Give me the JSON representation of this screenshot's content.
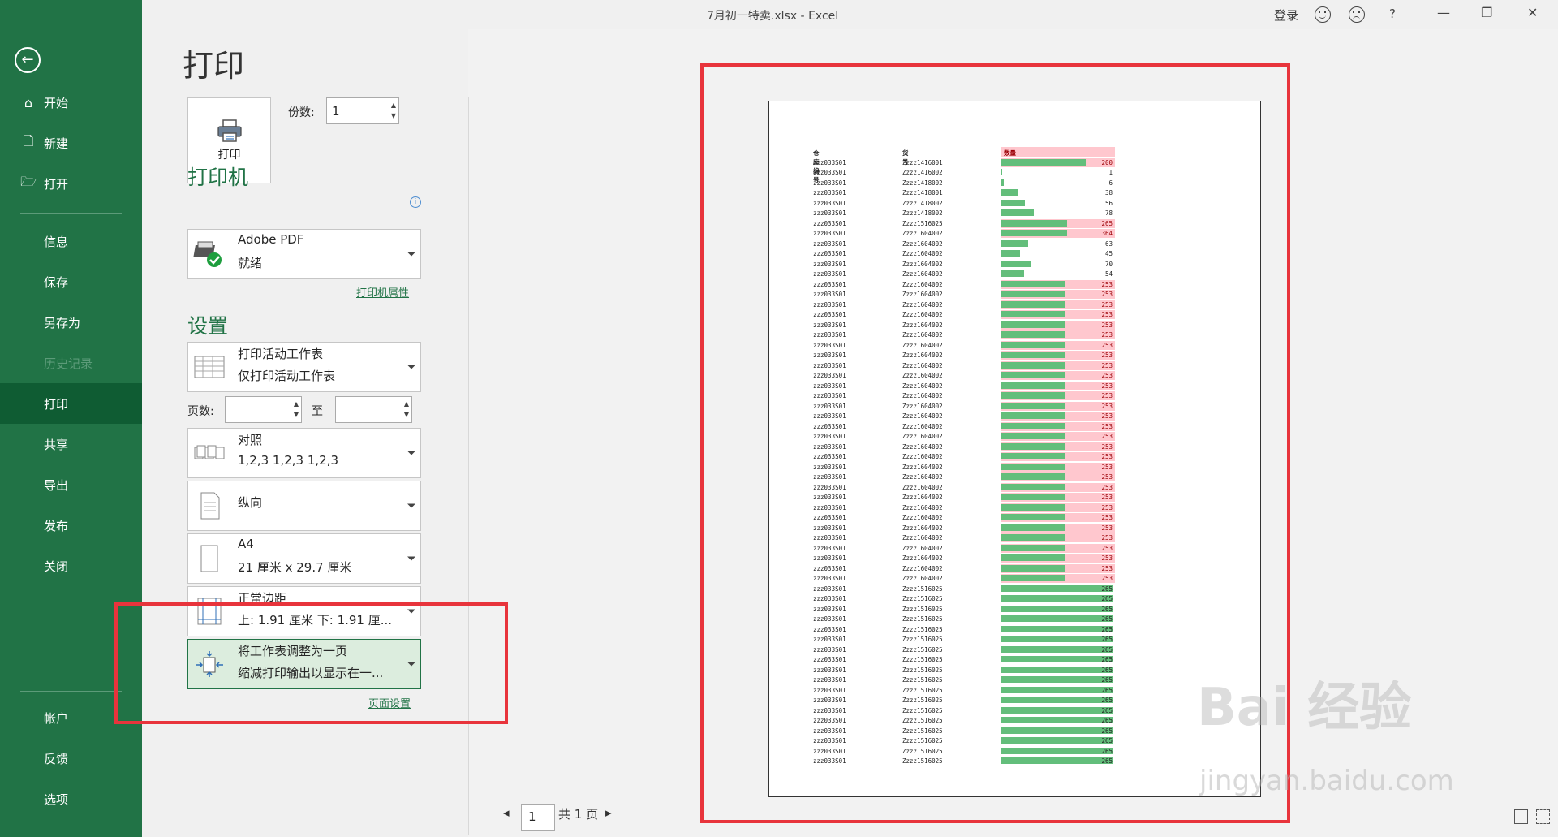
{
  "titlebar": {
    "doc_title": "7月初一特卖.xlsx  -  Excel",
    "signin": "登录",
    "help": "?",
    "minimize": "—",
    "restore": "❐",
    "close": "✕"
  },
  "backstage": {
    "back_glyph": "←",
    "items_top": [
      {
        "label": "开始",
        "icon": "home-icon",
        "glyph": "⌂"
      },
      {
        "label": "新建",
        "icon": "new-file-icon",
        "glyph": "🗋"
      },
      {
        "label": "打开",
        "icon": "open-folder-icon",
        "glyph": "🗁"
      }
    ],
    "items_mid": [
      "信息",
      "保存",
      "另存为",
      "历史记录",
      "打印",
      "共享",
      "导出",
      "发布",
      "关闭"
    ],
    "items_bottom": [
      "帐户",
      "反馈",
      "选项"
    ],
    "active": "打印",
    "disabled": "历史记录"
  },
  "print_panel": {
    "title": "打印",
    "print_button": "打印",
    "copies_label": "份数:",
    "copies_value": "1",
    "printer_heading": "打印机",
    "printer_name": "Adobe PDF",
    "printer_status": "就绪",
    "printer_props_link": "打印机属性",
    "settings_heading": "设置",
    "what_to_print": {
      "l1": "打印活动工作表",
      "l2": "仅打印活动工作表"
    },
    "pages_label": "页数:",
    "pages_to_label": "至",
    "collate": {
      "l1": "对照",
      "l2": "1,2,3     1,2,3     1,2,3"
    },
    "orientation": "纵向",
    "paper": {
      "l1": "A4",
      "l2": "21 厘米 x 29.7 厘米"
    },
    "margins": {
      "l1": "正常边距",
      "l2": "上: 1.91 厘米 下: 1.91 厘..."
    },
    "scaling": {
      "l1": "将工作表调整为一页",
      "l2": "缩减打印输出以显示在一..."
    },
    "page_setup_link": "页面设置"
  },
  "preview": {
    "page_number": "1",
    "total_pages": "共 1 页",
    "prev_glyph": "◂",
    "next_glyph": "▸",
    "sheet": {
      "headers": [
        "仓库编号",
        "货号",
        "数量"
      ],
      "max_value": 265,
      "rows": [
        [
          "zzz033S01",
          "Zzzz1416001",
          200,
          true
        ],
        [
          "zzz033S01",
          "Zzzz1416002",
          1,
          false
        ],
        [
          "zzz033S01",
          "Zzzz1418002",
          6,
          false
        ],
        [
          "zzz033S01",
          "Zzzz1418001",
          38,
          false
        ],
        [
          "zzz033S01",
          "Zzzz1418002",
          56,
          false
        ],
        [
          "zzz033S01",
          "Zzzz1418002",
          78,
          false
        ],
        [
          "zzz033S01",
          "Zzzz1516025",
          265,
          true
        ],
        [
          "zzz033S01",
          "Zzzz1604002",
          364,
          true
        ],
        [
          "zzz033S01",
          "Zzzz1604002",
          63,
          false
        ],
        [
          "zzz033S01",
          "Zzzz1604002",
          45,
          false
        ],
        [
          "zzz033S01",
          "Zzzz1604002",
          70,
          false
        ],
        [
          "zzz033S01",
          "Zzzz1604002",
          54,
          false
        ],
        [
          "zzz033S01",
          "Zzzz1604002",
          253,
          true
        ],
        [
          "zzz033S01",
          "Zzzz1604002",
          253,
          true
        ],
        [
          "zzz033S01",
          "Zzzz1604002",
          253,
          true
        ],
        [
          "zzz033S01",
          "Zzzz1604002",
          253,
          true
        ],
        [
          "zzz033S01",
          "Zzzz1604002",
          253,
          true
        ],
        [
          "zzz033S01",
          "Zzzz1604002",
          253,
          true
        ],
        [
          "zzz033S01",
          "Zzzz1604002",
          253,
          true
        ],
        [
          "zzz033S01",
          "Zzzz1604002",
          253,
          true
        ],
        [
          "zzz033S01",
          "Zzzz1604002",
          253,
          true
        ],
        [
          "zzz033S01",
          "Zzzz1604002",
          253,
          true
        ],
        [
          "zzz033S01",
          "Zzzz1604002",
          253,
          true
        ],
        [
          "zzz033S01",
          "Zzzz1604002",
          253,
          true
        ],
        [
          "zzz033S01",
          "Zzzz1604002",
          253,
          true
        ],
        [
          "zzz033S01",
          "Zzzz1604002",
          253,
          true
        ],
        [
          "zzz033S01",
          "Zzzz1604002",
          253,
          true
        ],
        [
          "zzz033S01",
          "Zzzz1604002",
          253,
          true
        ],
        [
          "zzz033S01",
          "Zzzz1604002",
          253,
          true
        ],
        [
          "zzz033S01",
          "Zzzz1604002",
          253,
          true
        ],
        [
          "zzz033S01",
          "Zzzz1604002",
          253,
          true
        ],
        [
          "zzz033S01",
          "Zzzz1604002",
          253,
          true
        ],
        [
          "zzz033S01",
          "Zzzz1604002",
          253,
          true
        ],
        [
          "zzz033S01",
          "Zzzz1604002",
          253,
          true
        ],
        [
          "zzz033S01",
          "Zzzz1604002",
          253,
          true
        ],
        [
          "zzz033S01",
          "Zzzz1604002",
          253,
          true
        ],
        [
          "zzz033S01",
          "Zzzz1604002",
          253,
          true
        ],
        [
          "zzz033S01",
          "Zzzz1604002",
          253,
          true
        ],
        [
          "zzz033S01",
          "Zzzz1604002",
          253,
          true
        ],
        [
          "zzz033S01",
          "Zzzz1604002",
          253,
          true
        ],
        [
          "zzz033S01",
          "Zzzz1604002",
          253,
          true
        ],
        [
          "zzz033S01",
          "Zzzz1604002",
          253,
          true
        ],
        [
          "zzz033S01",
          "Zzzz1516025",
          265,
          false
        ],
        [
          "zzz033S01",
          "Zzzz1516025",
          265,
          false
        ],
        [
          "zzz033S01",
          "Zzzz1516025",
          265,
          false
        ],
        [
          "zzz033S01",
          "Zzzz1516025",
          265,
          false
        ],
        [
          "zzz033S01",
          "Zzzz1516025",
          265,
          false
        ],
        [
          "zzz033S01",
          "Zzzz1516025",
          265,
          false
        ],
        [
          "zzz033S01",
          "Zzzz1516025",
          265,
          false
        ],
        [
          "zzz033S01",
          "Zzzz1516025",
          265,
          false
        ],
        [
          "zzz033S01",
          "Zzzz1516025",
          265,
          false
        ],
        [
          "zzz033S01",
          "Zzzz1516025",
          265,
          false
        ],
        [
          "zzz033S01",
          "Zzzz1516025",
          265,
          false
        ],
        [
          "zzz033S01",
          "Zzzz1516025",
          265,
          false
        ],
        [
          "zzz033S01",
          "Zzzz1516025",
          265,
          false
        ],
        [
          "zzz033S01",
          "Zzzz1516025",
          265,
          false
        ],
        [
          "zzz033S01",
          "Zzzz1516025",
          265,
          false
        ],
        [
          "zzz033S01",
          "Zzzz1516025",
          265,
          false
        ],
        [
          "zzz033S01",
          "Zzzz1516025",
          265,
          false
        ],
        [
          "zzz033S01",
          "Zzzz1516025",
          265,
          false
        ]
      ]
    }
  },
  "watermark": {
    "text1": "Bai 经验",
    "text2": "jingyan.baidu.com"
  },
  "colors": {
    "brand": "#217346",
    "active_nav": "#0f5c33",
    "highlight": "#e8343c",
    "databar": "#63be7b",
    "highfill": "#ffc7ce"
  }
}
